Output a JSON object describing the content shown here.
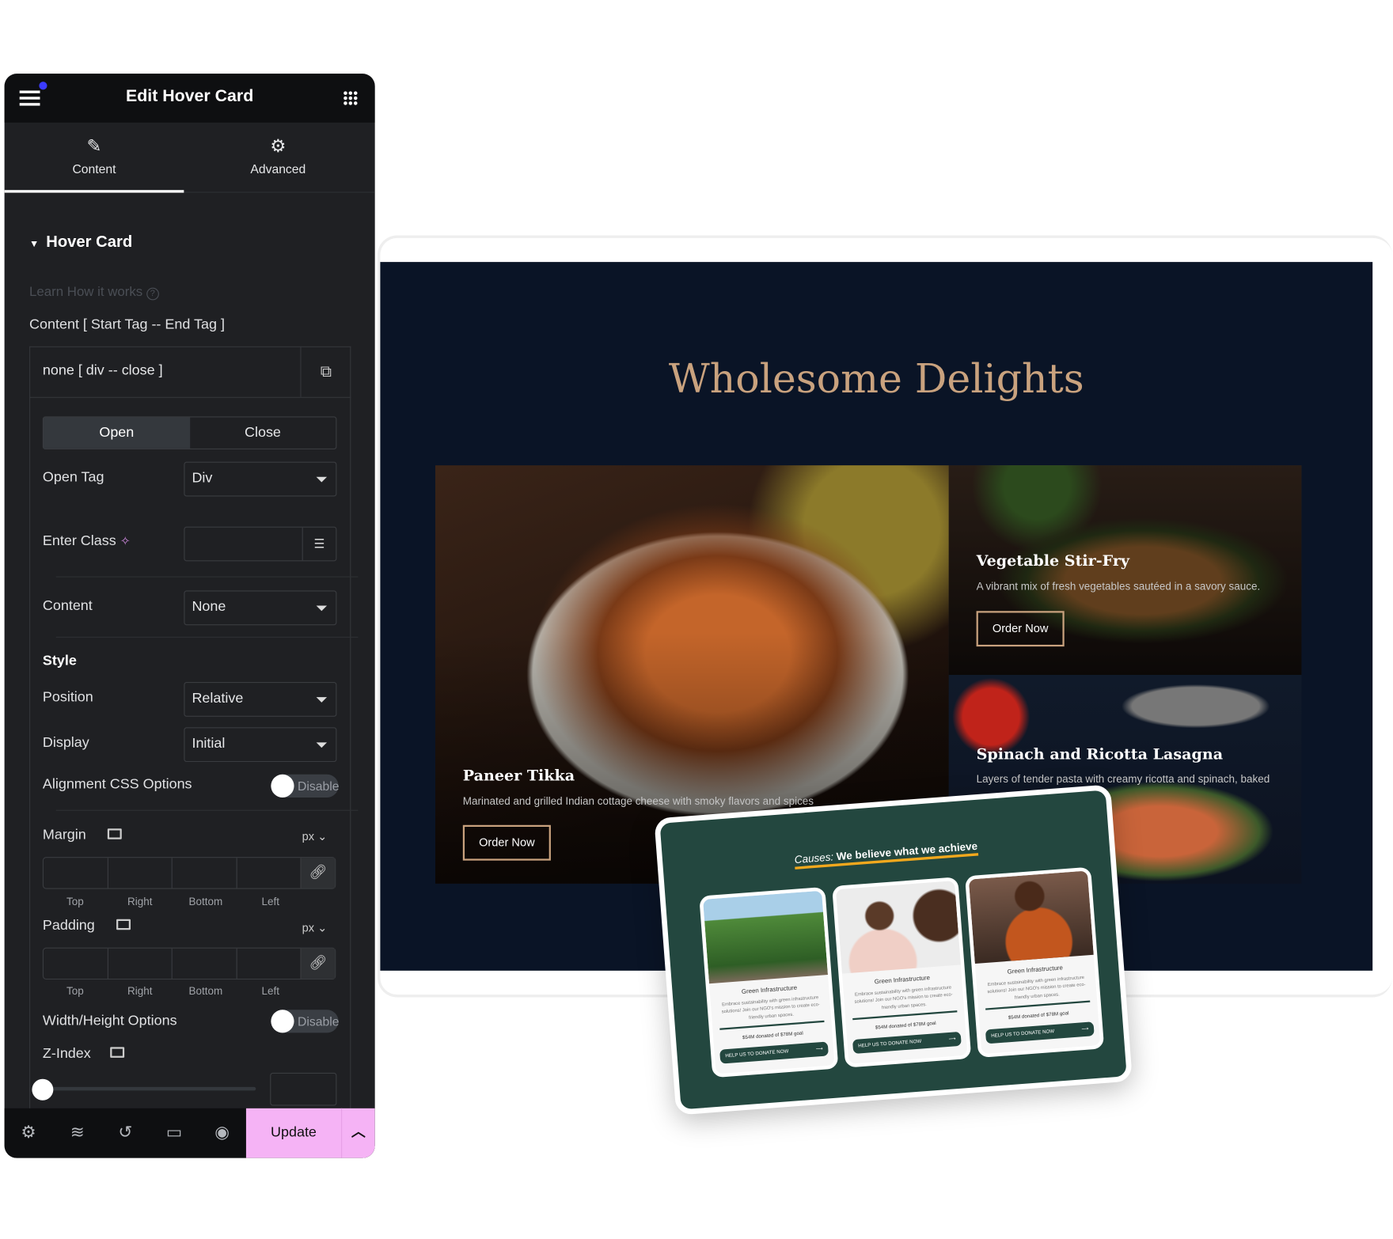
{
  "editor": {
    "title": "Edit Hover Card",
    "tabs": [
      {
        "label": "Content",
        "icon": "pencil-icon"
      },
      {
        "label": "Advanced",
        "icon": "gear-icon"
      }
    ],
    "section_title": "Hover Card",
    "learn_link": "Learn How it works",
    "content_label": "Content [ Start Tag -- End Tag ]",
    "content_value": "none [ div -- close ]",
    "open_close": [
      "Open",
      "Close"
    ],
    "open_tag": {
      "label": "Open Tag",
      "value": "Div"
    },
    "enter_class": {
      "label": "Enter Class",
      "value": ""
    },
    "content": {
      "label": "Content",
      "value": "None"
    },
    "style_heading": "Style",
    "position": {
      "label": "Position",
      "value": "Relative"
    },
    "display": {
      "label": "Display",
      "value": "Initial"
    },
    "alignment": {
      "label": "Alignment CSS Options",
      "toggle": "Disable"
    },
    "margin": {
      "label": "Margin",
      "unit": "px",
      "sides": [
        "Top",
        "Right",
        "Bottom",
        "Left"
      ]
    },
    "padding": {
      "label": "Padding",
      "unit": "px",
      "sides": [
        "Top",
        "Right",
        "Bottom",
        "Left"
      ]
    },
    "width_height": {
      "label": "Width/Height Options",
      "toggle": "Disable"
    },
    "zindex": {
      "label": "Z-Index",
      "slider_value": 0
    },
    "footer": {
      "update": "Update"
    },
    "colors": {
      "accent": "#f5b3f5",
      "notify_dot": "#3b3bff"
    }
  },
  "preview": {
    "title": "Wholesome Delights",
    "foods": [
      {
        "name": "Paneer Tikka",
        "desc": "Marinated and grilled Indian cottage cheese with smoky flavors and spices",
        "button": "Order Now"
      },
      {
        "name": "Vegetable Stir-Fry",
        "desc": "A vibrant mix of fresh vegetables sautéed in a savory sauce.",
        "button": "Order Now"
      },
      {
        "name": "Spinach and Ricotta Lasagna",
        "desc": "Layers of tender pasta with creamy ricotta and spinach, baked"
      }
    ],
    "causes": {
      "title_italic": "Causes:",
      "title_rest": "We believe what we achieve",
      "cards": [
        {
          "heading": "Green Infrastructure",
          "text": "Embrace sustainability with green infrastructure solutions! Join our NGO's mission to create eco-friendly urban spaces.",
          "goal": "$54M donated of $78M goal",
          "button": "HELP US TO DONATE NOW"
        },
        {
          "heading": "Green Infrastructure",
          "text": "Embrace sustainability with green infrastructure solutions! Join our NGO's mission to create eco-friendly urban spaces.",
          "goal": "$54M donated of $78M goal",
          "button": "HELP US TO DONATE NOW"
        },
        {
          "heading": "Green Infrastructure",
          "text": "Embrace sustainability with green infrastructure solutions! Join our NGO's mission to create eco-friendly urban spaces.",
          "goal": "$54M donated of $78M goal",
          "button": "HELP US TO DONATE NOW"
        }
      ]
    }
  }
}
